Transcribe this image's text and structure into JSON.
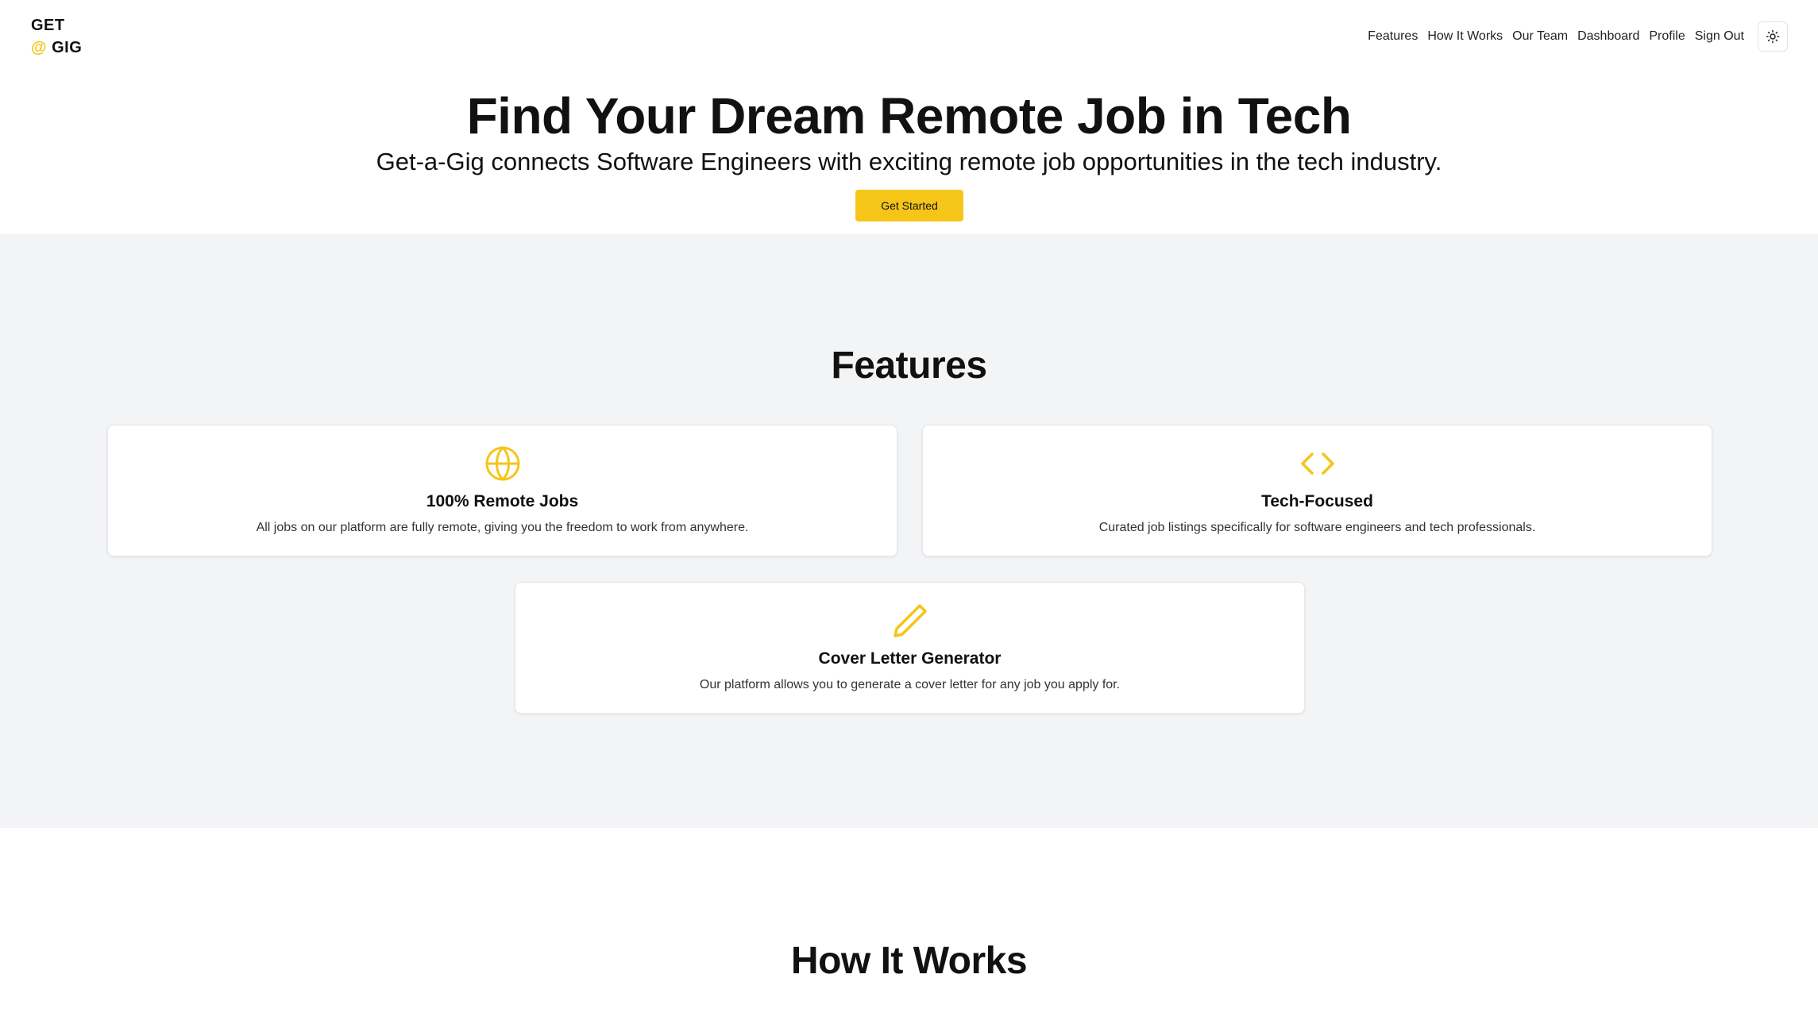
{
  "brand": {
    "line1": "GET",
    "at": "@",
    "line2": "GIG",
    "accent_color": "#f5c518"
  },
  "nav": {
    "items": [
      "Features",
      "How It Works",
      "Our Team",
      "Dashboard",
      "Profile",
      "Sign Out"
    ],
    "theme_toggle_icon": "sun-icon"
  },
  "hero": {
    "title": "Find Your Dream Remote Job in Tech",
    "subtitle": "Get-a-Gig connects Software Engineers with exciting remote job opportunities in the tech industry.",
    "cta_label": "Get Started"
  },
  "features": {
    "heading": "Features",
    "cards": [
      {
        "icon": "globe-icon",
        "title": "100% Remote Jobs",
        "description": "All jobs on our platform are fully remote, giving you the freedom to work from anywhere."
      },
      {
        "icon": "code-icon",
        "title": "Tech-Focused",
        "description": "Curated job listings specifically for software engineers and tech professionals."
      },
      {
        "icon": "pencil-icon",
        "title": "Cover Letter Generator",
        "description": "Our platform allows you to generate a cover letter for any job you apply for."
      }
    ]
  },
  "how_it_works": {
    "heading": "How It Works"
  }
}
